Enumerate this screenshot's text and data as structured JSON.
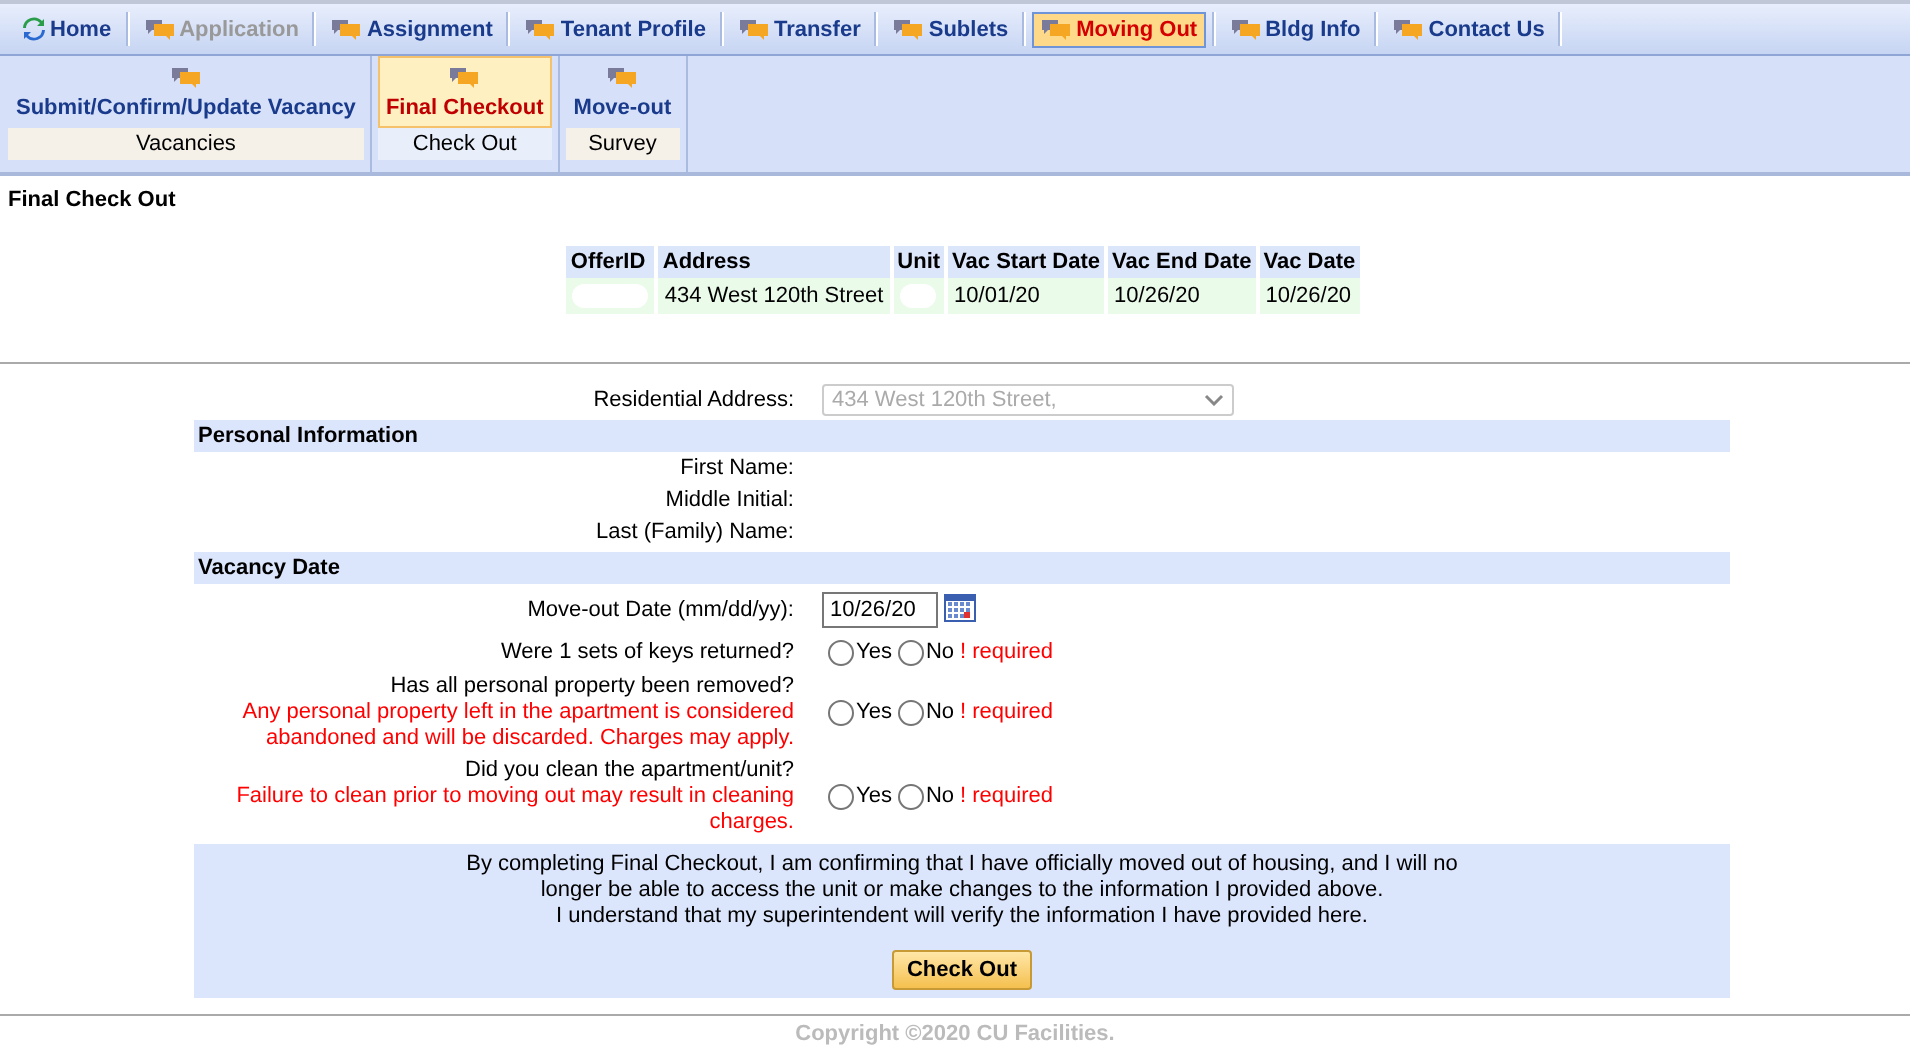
{
  "top_nav": [
    {
      "label": "Home",
      "kind": "home",
      "selected": false,
      "disabled": false
    },
    {
      "label": "Application",
      "kind": "chat",
      "selected": false,
      "disabled": true
    },
    {
      "label": "Assignment",
      "kind": "chat",
      "selected": false,
      "disabled": false
    },
    {
      "label": "Tenant Profile",
      "kind": "chat",
      "selected": false,
      "disabled": false
    },
    {
      "label": "Transfer",
      "kind": "chat",
      "selected": false,
      "disabled": false
    },
    {
      "label": "Sublets",
      "kind": "chat",
      "selected": false,
      "disabled": false
    },
    {
      "label": "Moving Out",
      "kind": "chat",
      "selected": true,
      "disabled": false
    },
    {
      "label": "Bldg Info",
      "kind": "chat",
      "selected": false,
      "disabled": false
    },
    {
      "label": "Contact Us",
      "kind": "chat",
      "selected": false,
      "disabled": false
    }
  ],
  "sub_nav": [
    {
      "label": "Submit/Confirm/Update Vacancy",
      "group": "Vacancies",
      "selected": false
    },
    {
      "label": "Final Checkout",
      "group": "Check Out",
      "selected": true
    },
    {
      "label": "Move-out",
      "group": "Survey",
      "selected": false
    }
  ],
  "page_title": "Final Check Out",
  "offer_table": {
    "columns": [
      "OfferID",
      "Address",
      "Unit",
      "Vac Start Date",
      "Vac End Date",
      "Vac Date"
    ],
    "rows": [
      {
        "cells": [
          {
            "kind": "blank"
          },
          {
            "kind": "text",
            "text": "434 West 120th Street"
          },
          {
            "kind": "blank"
          },
          {
            "kind": "text",
            "text": "10/01/20"
          },
          {
            "kind": "text",
            "text": "10/26/20"
          },
          {
            "kind": "text",
            "text": "10/26/20"
          }
        ]
      }
    ]
  },
  "form": {
    "residential_address": {
      "label": "Residential Address:",
      "value": "434 West 120th Street,",
      "disabled": true
    },
    "sections": [
      {
        "title": "Personal Information",
        "rows": [
          {
            "kind": "label",
            "label": "First Name:"
          },
          {
            "kind": "label",
            "label": "Middle Initial:"
          },
          {
            "kind": "label",
            "label": "Last (Family) Name:"
          }
        ]
      },
      {
        "title": "Vacancy Date",
        "rows": [
          {
            "kind": "date",
            "label": "Move-out Date (mm/dd/yy):",
            "value": "10/26/20"
          },
          {
            "kind": "question",
            "label": "Were 1 sets of keys returned?",
            "options": [
              {
                "label": "Yes",
                "selected": false
              },
              {
                "label": "No",
                "selected": false
              }
            ],
            "required": "! required"
          },
          {
            "kind": "question",
            "label": "Has all personal property been removed?",
            "note": "Any personal property left in the apartment is considered abandoned and will be discarded. Charges may apply.",
            "options": [
              {
                "label": "Yes",
                "selected": false
              },
              {
                "label": "No",
                "selected": false
              }
            ],
            "required": "! required"
          },
          {
            "kind": "question",
            "label": "Did you clean the apartment/unit?",
            "note": "Failure to clean prior to moving out may result in cleaning charges.",
            "options": [
              {
                "label": "Yes",
                "selected": false
              },
              {
                "label": "No",
                "selected": false
              }
            ],
            "required": "! required"
          }
        ]
      }
    ],
    "notice": [
      "By completing Final Checkout, I am confirming that I have officially moved out of housing, and I will no longer be able to access the unit or make changes to the information I provided above.",
      "I understand that my superintendent will verify the information I have provided here."
    ],
    "submit": "Check Out"
  },
  "footer": "Copyright ©2020 CU Facilities."
}
